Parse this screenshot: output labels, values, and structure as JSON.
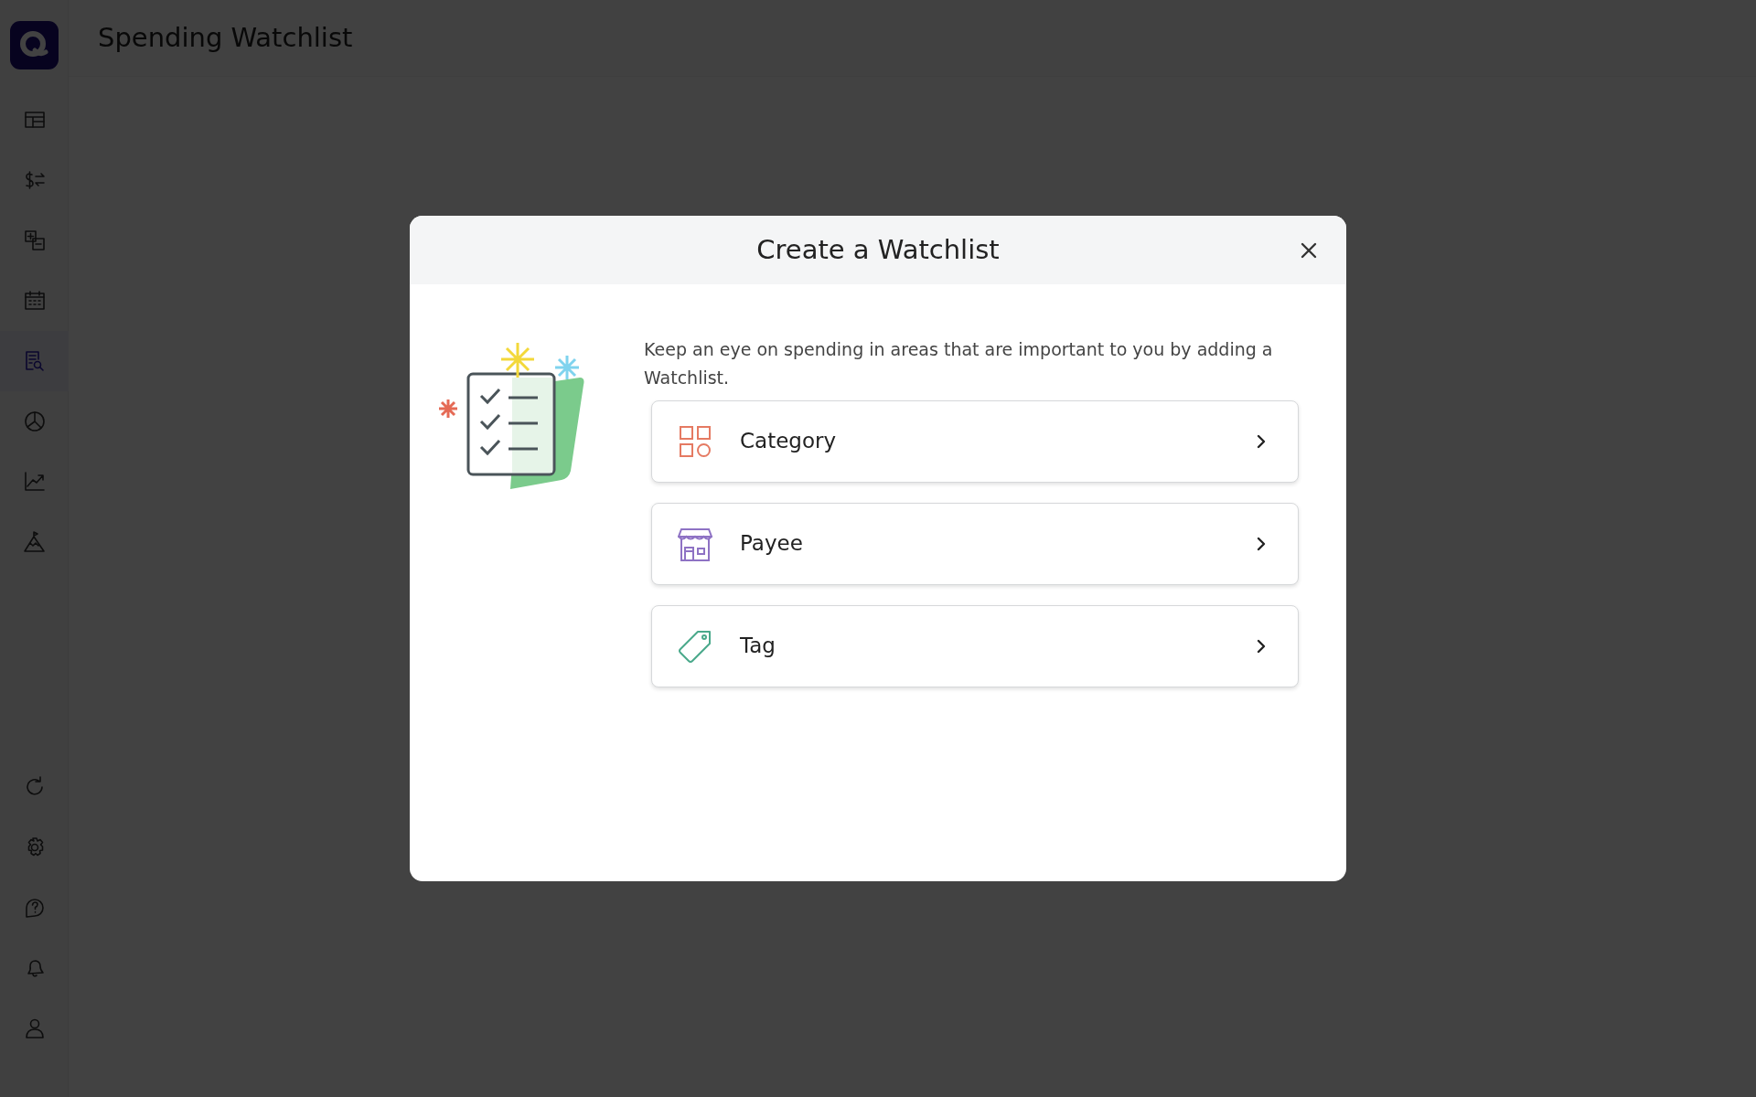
{
  "page": {
    "title": "Spending Watchlist"
  },
  "sidebar": {
    "top_items": [
      {
        "selected": false
      },
      {
        "selected": false
      },
      {
        "selected": false
      },
      {
        "selected": false
      },
      {
        "selected": true
      },
      {
        "selected": false
      },
      {
        "selected": false
      },
      {
        "selected": false
      }
    ],
    "bottom_items": [
      {
        "selected": false
      },
      {
        "selected": false
      },
      {
        "selected": false
      },
      {
        "selected": false
      },
      {
        "selected": false
      }
    ]
  },
  "modal": {
    "title": "Create a Watchlist",
    "description": "Keep an eye on spending in areas that are important to you by adding a Watchlist.",
    "options": [
      {
        "label": "Category"
      },
      {
        "label": "Payee"
      },
      {
        "label": "Tag"
      }
    ]
  }
}
